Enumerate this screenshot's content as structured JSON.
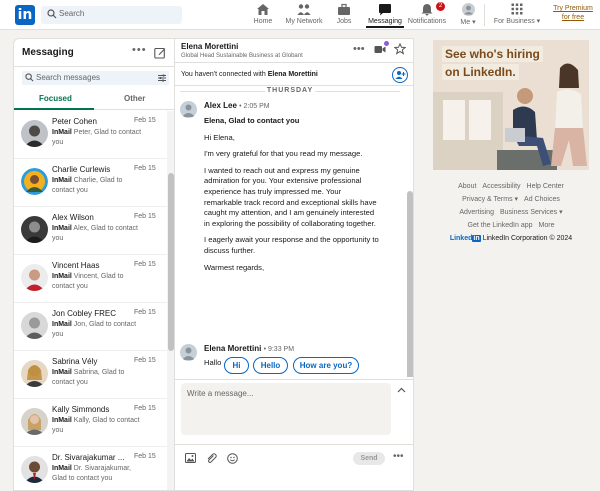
{
  "topnav": {
    "search_placeholder": "Search",
    "items": [
      {
        "label": "Home",
        "icon": "home-icon"
      },
      {
        "label": "My Network",
        "icon": "network-icon"
      },
      {
        "label": "Jobs",
        "icon": "briefcase-icon"
      },
      {
        "label": "Messaging",
        "icon": "messaging-icon",
        "active": true
      },
      {
        "label": "Notifications",
        "icon": "bell-icon",
        "badge": "2"
      },
      {
        "label": "Me ▾",
        "icon": "avatar"
      },
      {
        "label": "For Business ▾",
        "icon": "grid-icon"
      }
    ],
    "premium": "Try Premium for free"
  },
  "messaging": {
    "title": "Messaging",
    "search_placeholder": "Search messages",
    "tabs": [
      "Focused",
      "Other"
    ],
    "conversations": [
      {
        "name": "Peter Cohen",
        "date": "Feb 15",
        "kind": "InMail",
        "snippet": "Peter, Glad to contact you"
      },
      {
        "name": "Charlie Curlewis",
        "date": "Feb 15",
        "kind": "InMail",
        "snippet": "Charlie, Glad to contact you"
      },
      {
        "name": "Alex Wilson",
        "date": "Feb 15",
        "kind": "InMail",
        "snippet": "Alex, Glad to contact you"
      },
      {
        "name": "Vincent Haas",
        "date": "Feb 15",
        "kind": "InMail",
        "snippet": "Vincent, Glad to contact you"
      },
      {
        "name": "Jon Cobley FREC",
        "date": "Feb 15",
        "kind": "InMail",
        "snippet": "Jon, Glad to contact you"
      },
      {
        "name": "Sabrina Vély",
        "date": "Feb 15",
        "kind": "InMail",
        "snippet": "Sabrina, Glad to contact you"
      },
      {
        "name": "Kally Simmonds",
        "date": "Feb 15",
        "kind": "InMail",
        "snippet": "Kally, Glad to contact you"
      },
      {
        "name": "Dr. Sivarajakumar ...",
        "date": "Feb 15",
        "kind": "InMail",
        "snippet": "Dr. Sivarajakumar, Glad to contact you"
      }
    ]
  },
  "conversation": {
    "name": "Elena Morettini",
    "headline": "Global Head Sustainable Business at Globant",
    "notice_prefix": "You haven't connected with ",
    "notice_name": "Elena Morettini",
    "day": "THURSDAY",
    "msg1": {
      "sender": "Alex Lee",
      "time": "• 2:05 PM",
      "subject": "Elena, Glad to contact you",
      "paragraphs": [
        "Hi Elena,",
        "I'm very grateful for that you read my message.",
        "I wanted to reach out and express my genuine admiration for you. Your extensive professional experience has truly impressed me. Your remarkable track record and exceptional skills have caught my attention, and I am genuinely interested in exploring the possibility of collaborating together.",
        "I eagerly await your response and the opportunity to discuss further.",
        "Warmest regards,"
      ]
    },
    "msg2": {
      "sender": "Elena Morettini",
      "time": "• 9:33 PM",
      "text": "Hallo"
    },
    "quick_replies": [
      "Hi",
      "Hello",
      "How are you?"
    ],
    "composer_placeholder": "Write a message...",
    "send_label": "Send"
  },
  "ad": {
    "line1": "See who's hiring",
    "line2": "on LinkedIn."
  },
  "footer_links": {
    "row1": [
      "About",
      "Accessibility",
      "Help Center"
    ],
    "row2": [
      "Privacy & Terms ▾",
      "Ad Choices"
    ],
    "row3": [
      "Advertising",
      "Business Services ▾"
    ],
    "row4": [
      "Get the LinkedIn app",
      "More"
    ]
  },
  "brand": {
    "word": "Linked",
    "in": "in",
    "copyright": "LinkedIn Corporation © 2024"
  }
}
